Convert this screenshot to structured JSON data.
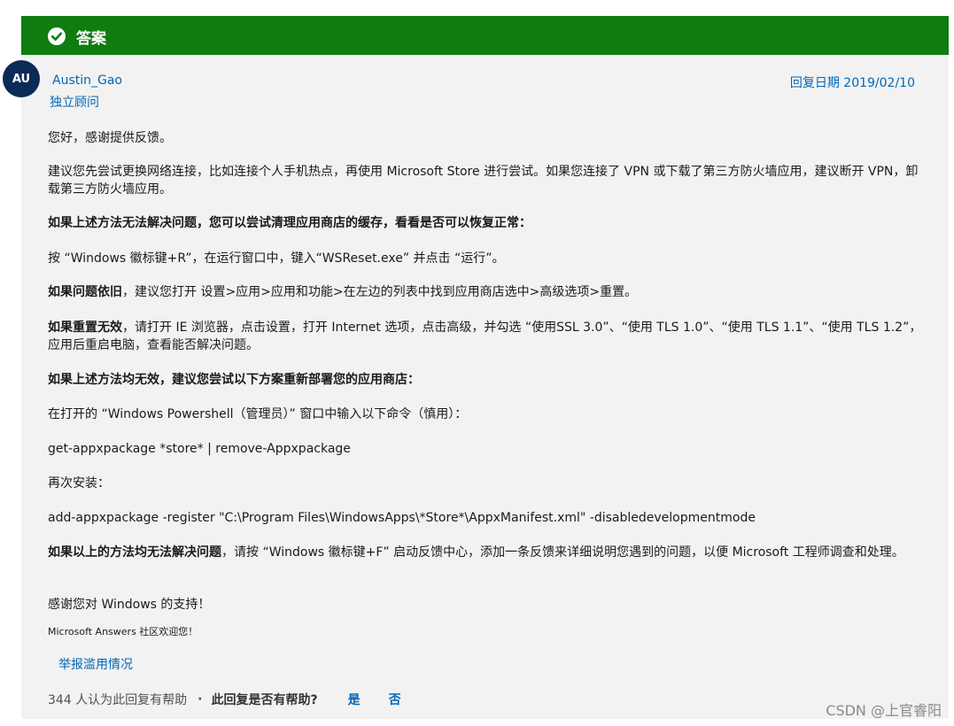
{
  "answer_bar": {
    "label": "答案"
  },
  "author": {
    "initials": "AU",
    "name": "Austin_Gao",
    "role": "独立顾问"
  },
  "reply_date": "回复日期 2019/02/10",
  "body": {
    "p1": "您好，感谢提供反馈。",
    "p2": "建议您先尝试更换网络连接，比如连接个人手机热点，再使用 Microsoft Store 进行尝试。如果您连接了 VPN 或下载了第三方防火墙应用，建议断开 VPN，卸载第三方防火墙应用。",
    "p3": "如果上述方法无法解决问题，您可以尝试清理应用商店的缓存，看看是否可以恢复正常：",
    "p4": "按 “Windows 徽标键+R”，在运行窗口中，键入“WSReset.exe” 并点击 “运行”。",
    "p5_bold": "如果问题依旧",
    "p5_rest": "，建议您打开 设置>应用>应用和功能>在左边的列表中找到应用商店选中>高级选项>重置。",
    "p6_bold": "如果重置无效",
    "p6_rest": "，请打开 IE 浏览器，点击设置，打开 Internet 选项，点击高级，并勾选 “使用SSL 3.0”、“使用 TLS 1.0”、“使用 TLS 1.1”、“使用 TLS 1.2”，应用后重启电脑，查看能否解决问题。",
    "p7": "如果上述方法均无效，建议您尝试以下方案重新部署您的应用商店：",
    "p8": "在打开的 “Windows Powershell（管理员）” 窗口中输入以下命令（慎用）：",
    "p9": "get-appxpackage *store* | remove-Appxpackage",
    "p10": "再次安装：",
    "p11": "add-appxpackage -register \"C:\\Program Files\\WindowsApps\\*Store*\\AppxManifest.xml\" -disabledevelopmentmode",
    "p12_bold": "如果以上的方法均无法解决问题",
    "p12_rest": "，请按 “Windows 徽标键+F” 启动反馈中心，添加一条反馈来详细说明您遇到的问题，以便 Microsoft 工程师调查和处理。",
    "p13": "感谢您对 Windows 的支持！",
    "p14": "Microsoft Answers 社区欢迎您！"
  },
  "report_link": "举报滥用情况",
  "footer": {
    "helpful_count": "344 人认为此回复有帮助",
    "separator": "·",
    "question": "此回复是否有帮助?",
    "yes": "是",
    "no": "否"
  },
  "watermark": "CSDN @上官睿阳",
  "colors": {
    "accent_green": "#107c10",
    "link_blue": "#0067b8",
    "avatar_bg": "#0b2a55"
  }
}
